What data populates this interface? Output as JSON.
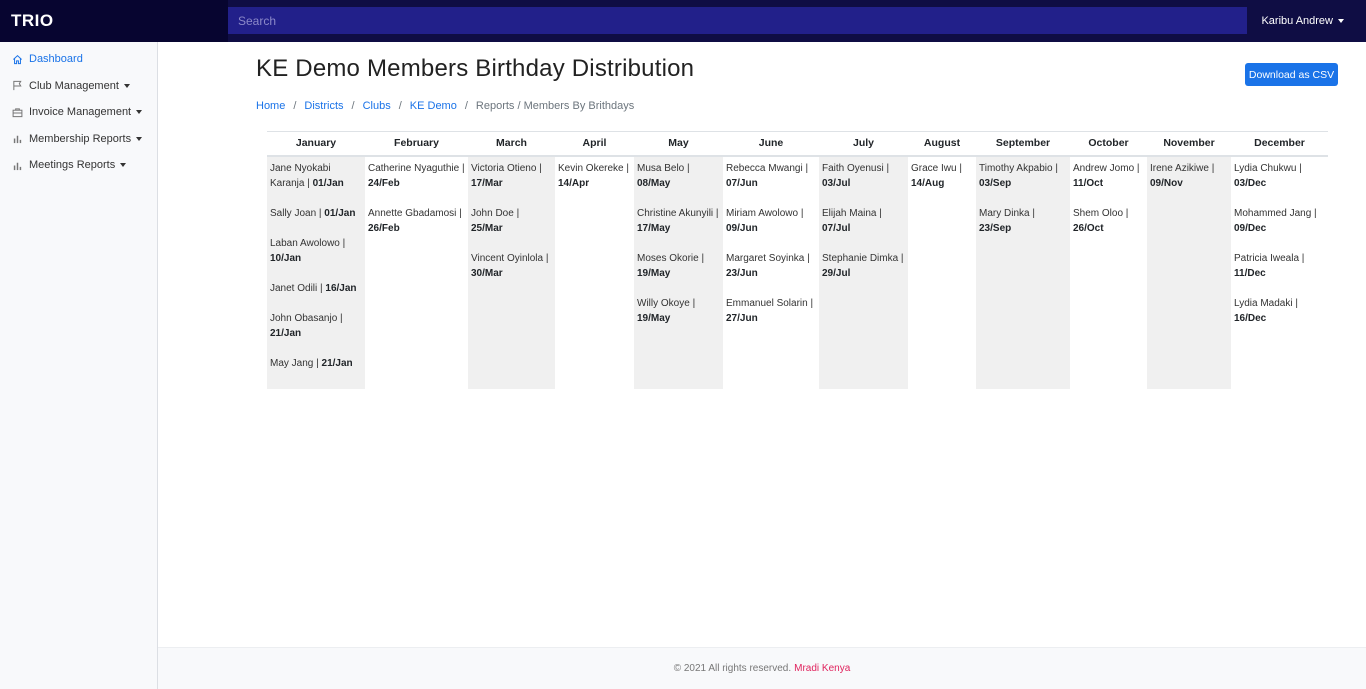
{
  "app": {
    "brand": "TRIO"
  },
  "search": {
    "placeholder": "Search"
  },
  "user": {
    "greeting": "Karibu Andrew"
  },
  "sidebar": {
    "items": [
      {
        "label": "Dashboard",
        "icon": "home-icon",
        "active": true,
        "dropdown": false
      },
      {
        "label": "Club Management",
        "icon": "flag-icon",
        "active": false,
        "dropdown": true
      },
      {
        "label": "Invoice Management",
        "icon": "briefcase-icon",
        "active": false,
        "dropdown": true
      },
      {
        "label": "Membership Reports",
        "icon": "bar-chart-icon",
        "active": false,
        "dropdown": true
      },
      {
        "label": "Meetings Reports",
        "icon": "bar-chart-icon",
        "active": false,
        "dropdown": true
      }
    ]
  },
  "page": {
    "title": "KE Demo Members Birthday Distribution",
    "download_label": "Download as CSV",
    "breadcrumb": {
      "home": "Home",
      "districts": "Districts",
      "clubs": "Clubs",
      "club": "KE Demo",
      "current": "Reports / Members By Brithdays"
    }
  },
  "months": [
    {
      "name": "January",
      "shaded": true,
      "entries": [
        {
          "name": "Jane Nyokabi Karanja",
          "date": "01/Jan"
        },
        {
          "name": "Sally Joan",
          "date": "01/Jan"
        },
        {
          "name": "Laban Awolowo",
          "date": "10/Jan"
        },
        {
          "name": "Janet Odili",
          "date": "16/Jan"
        },
        {
          "name": "John Obasanjo",
          "date": "21/Jan"
        },
        {
          "name": "May Jang",
          "date": "21/Jan"
        }
      ]
    },
    {
      "name": "February",
      "shaded": false,
      "entries": [
        {
          "name": "Catherine Nyaguthie",
          "date": "24/Feb"
        },
        {
          "name": "Annette Gbadamosi",
          "date": "26/Feb"
        }
      ]
    },
    {
      "name": "March",
      "shaded": true,
      "entries": [
        {
          "name": "Victoria Otieno",
          "date": "17/Mar"
        },
        {
          "name": "John Doe",
          "date": "25/Mar"
        },
        {
          "name": "Vincent Oyinlola",
          "date": "30/Mar"
        }
      ]
    },
    {
      "name": "April",
      "shaded": false,
      "entries": [
        {
          "name": "Kevin Okereke",
          "date": "14/Apr"
        }
      ]
    },
    {
      "name": "May",
      "shaded": true,
      "entries": [
        {
          "name": "Musa Belo",
          "date": "08/May"
        },
        {
          "name": "Christine Akunyili",
          "date": "17/May"
        },
        {
          "name": "Moses Okorie",
          "date": "19/May"
        },
        {
          "name": "Willy Okoye",
          "date": "19/May"
        }
      ]
    },
    {
      "name": "June",
      "shaded": false,
      "entries": [
        {
          "name": "Rebecca Mwangi",
          "date": "07/Jun"
        },
        {
          "name": "Miriam Awolowo",
          "date": "09/Jun"
        },
        {
          "name": "Margaret Soyinka",
          "date": "23/Jun"
        },
        {
          "name": "Emmanuel Solarin",
          "date": "27/Jun"
        }
      ]
    },
    {
      "name": "July",
      "shaded": true,
      "entries": [
        {
          "name": "Faith Oyenusi",
          "date": "03/Jul"
        },
        {
          "name": "Elijah Maina",
          "date": "07/Jul"
        },
        {
          "name": "Stephanie Dimka",
          "date": "29/Jul"
        }
      ]
    },
    {
      "name": "August",
      "shaded": false,
      "entries": [
        {
          "name": "Grace Iwu",
          "date": "14/Aug"
        }
      ]
    },
    {
      "name": "September",
      "shaded": true,
      "entries": [
        {
          "name": "Timothy Akpabio",
          "date": "03/Sep"
        },
        {
          "name": "Mary Dinka",
          "date": "23/Sep"
        }
      ]
    },
    {
      "name": "October",
      "shaded": false,
      "entries": [
        {
          "name": "Andrew Jomo",
          "date": "11/Oct"
        },
        {
          "name": "Shem Oloo",
          "date": "26/Oct"
        }
      ]
    },
    {
      "name": "November",
      "shaded": true,
      "entries": [
        {
          "name": "Irene Azikiwe",
          "date": "09/Nov"
        }
      ]
    },
    {
      "name": "December",
      "shaded": false,
      "entries": [
        {
          "name": "Lydia Chukwu",
          "date": "03/Dec"
        },
        {
          "name": "Mohammed Jang",
          "date": "09/Dec"
        },
        {
          "name": "Patricia Iweala",
          "date": "11/Dec"
        },
        {
          "name": "Lydia Madaki",
          "date": "16/Dec"
        }
      ]
    }
  ],
  "footer": {
    "copyright": "© 2021 All rights reserved.",
    "company": "Mradi Kenya"
  },
  "colors": {
    "topbar": "#0f0d44",
    "brand_bg": "#070530",
    "search_bg": "#22208a",
    "accent": "#1a73e8",
    "footer_link": "#e0245e",
    "shade": "#f0f0f0"
  }
}
